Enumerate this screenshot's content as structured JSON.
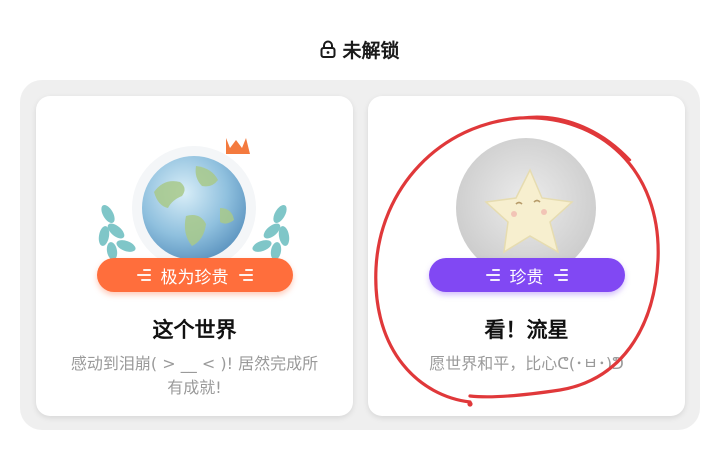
{
  "header": {
    "lock_icon": "lock-icon",
    "title": "未解锁"
  },
  "achievements": [
    {
      "medal_icon": "globe-icon",
      "rarity": "极为珍贵",
      "rarity_color": "#ff6e3c",
      "title": "这个世界",
      "desc_line1": "感动到泪崩( > __ < )!  居然完成所",
      "desc_line2": "有成就!"
    },
    {
      "medal_icon": "star-icon",
      "rarity": "珍贵",
      "rarity_color": "#8148f3",
      "title": "看！流星",
      "desc_line1": "愿世界和平，比心ᕦ(･ㅂ･)ᕤ",
      "desc_line2": ""
    }
  ],
  "annotation_color": "#e0383a"
}
